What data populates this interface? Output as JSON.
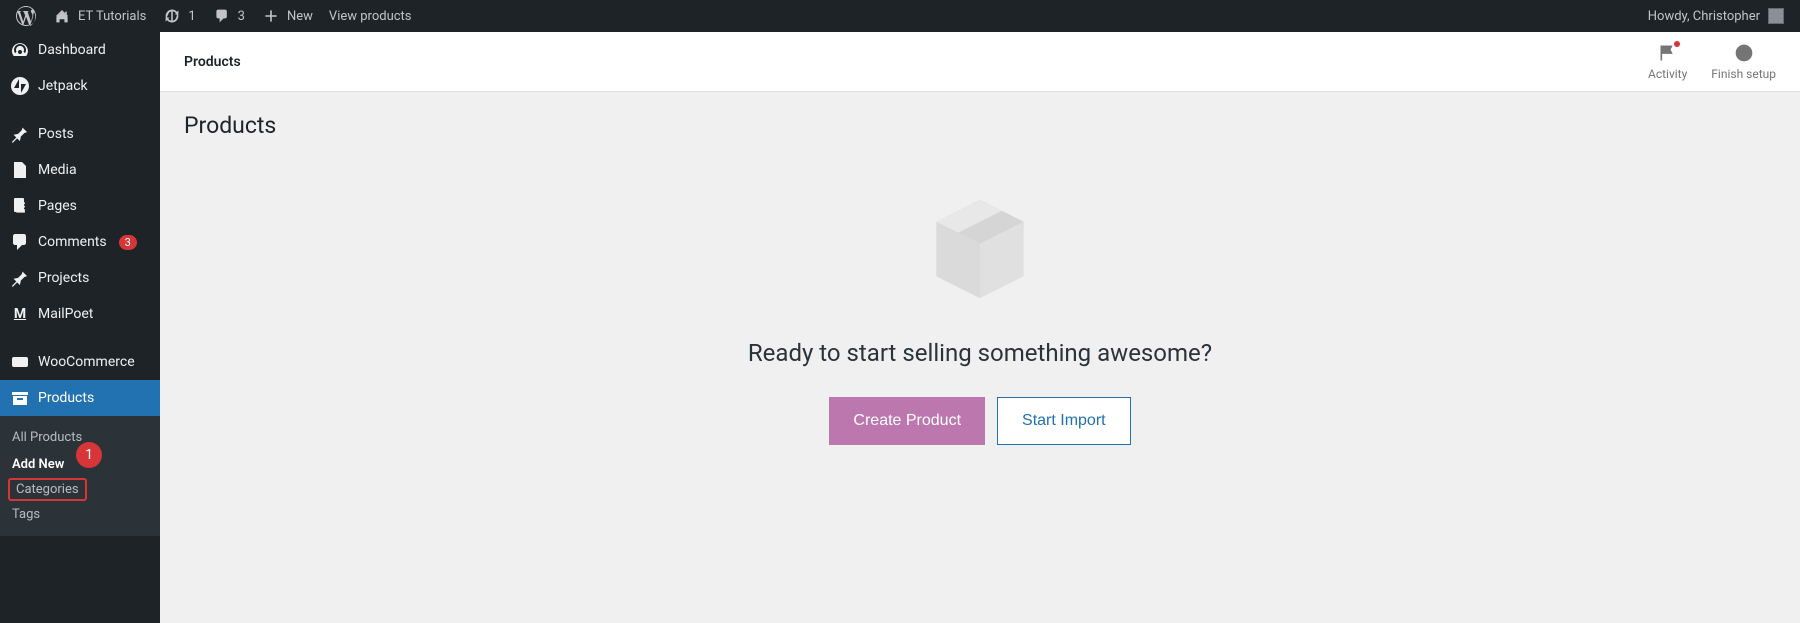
{
  "adminBar": {
    "siteName": "ET Tutorials",
    "updates": "1",
    "comments": "3",
    "new": "New",
    "viewProducts": "View products",
    "greeting": "Howdy, Christopher"
  },
  "sidebar": {
    "dashboard": "Dashboard",
    "jetpack": "Jetpack",
    "posts": "Posts",
    "media": "Media",
    "pages": "Pages",
    "comments": "Comments",
    "commentsBadge": "3",
    "projects": "Projects",
    "mailpoet": "MailPoet",
    "woocommerce": "WooCommerce",
    "products": "Products"
  },
  "submenu": {
    "allProducts": "All Products",
    "addNew": "Add New",
    "categories": "Categories",
    "tags": "Tags"
  },
  "callout": "1",
  "topbar": {
    "title": "Products",
    "activity": "Activity",
    "finishSetup": "Finish setup"
  },
  "page": {
    "title": "Products",
    "emptyHeading": "Ready to start selling something awesome?",
    "createProduct": "Create Product",
    "startImport": "Start Import"
  }
}
